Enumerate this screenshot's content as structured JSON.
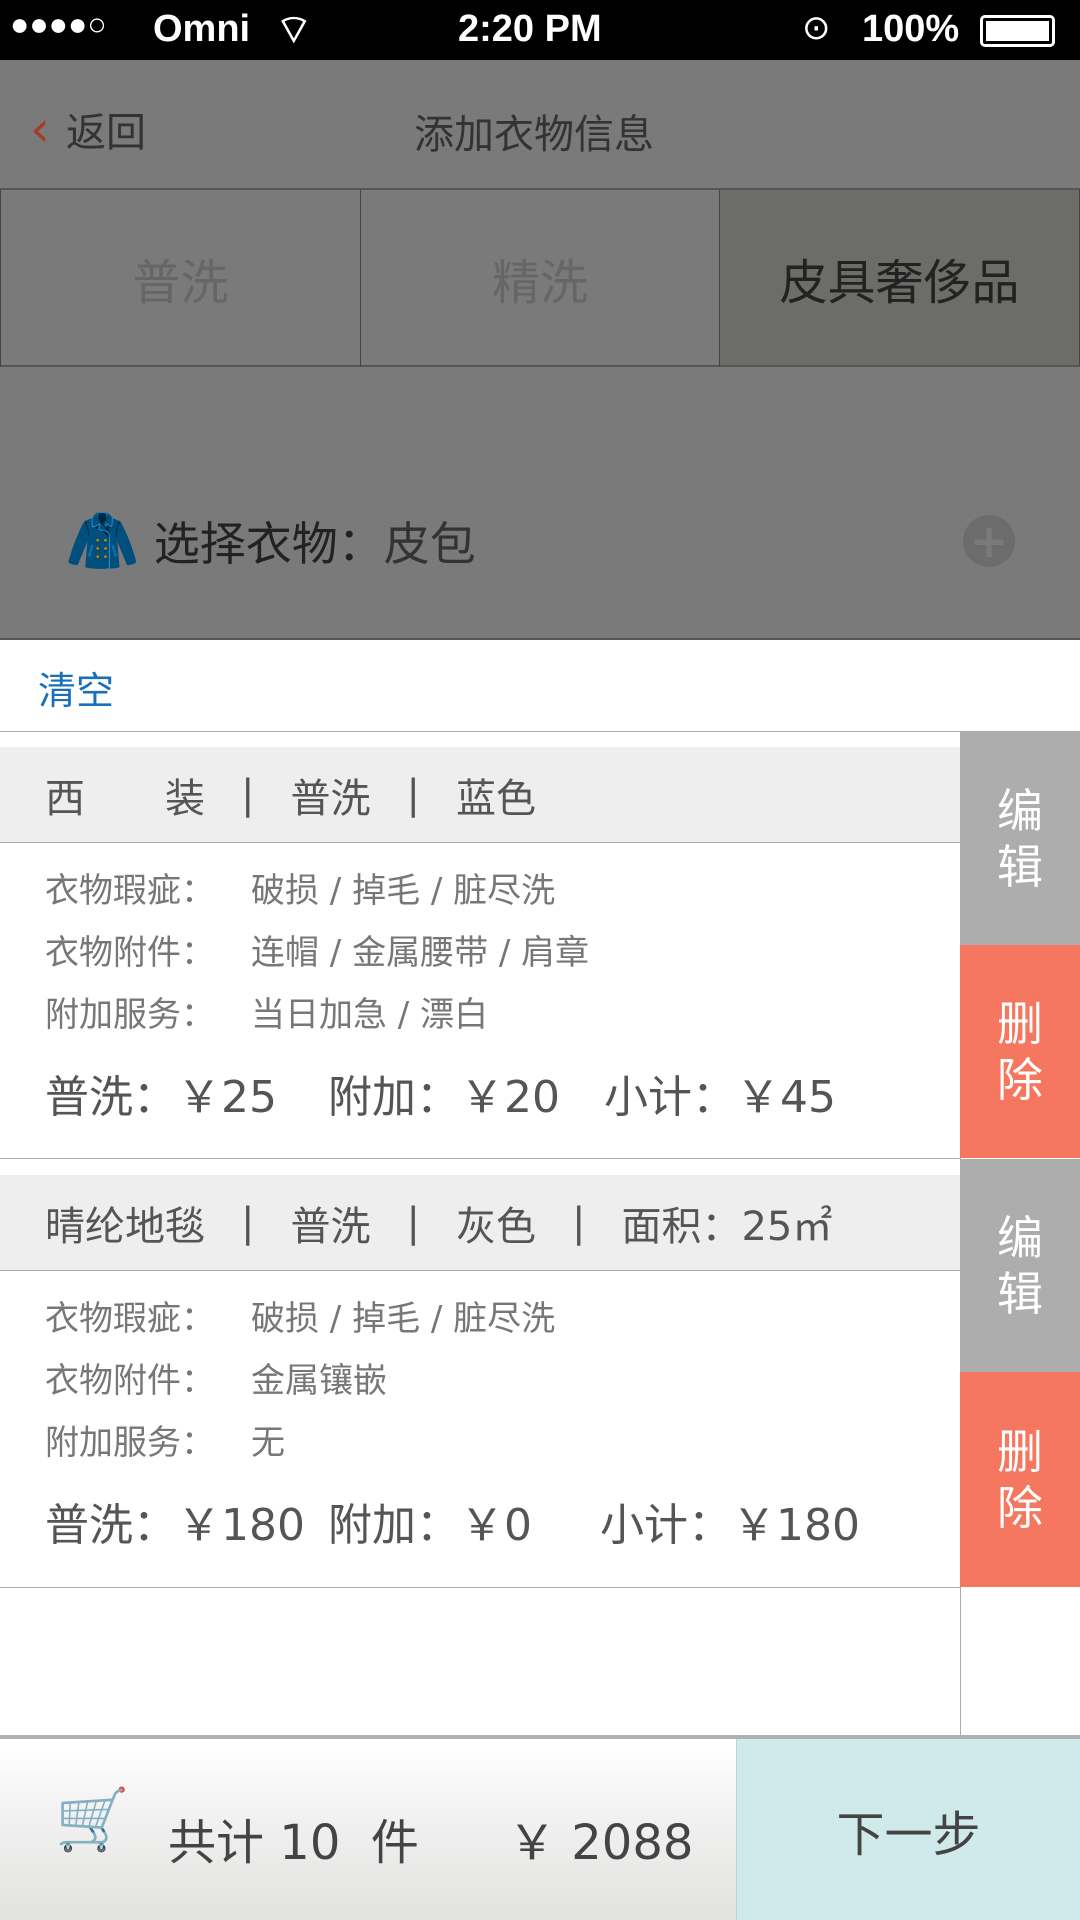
{
  "status_bar": {
    "signal": "●●●●○",
    "carrier": "Omni",
    "time": "2:20 PM",
    "battery": "100%"
  },
  "nav": {
    "back_label": "返回",
    "title": "添加衣物信息"
  },
  "tabs": [
    {
      "label": "普洗",
      "active": false
    },
    {
      "label": "精洗",
      "active": false
    },
    {
      "label": "皮具奢侈品",
      "active": true
    }
  ],
  "select": {
    "label": "选择衣物：",
    "value": "皮包"
  },
  "clear_label": "清空",
  "items": [
    {
      "head": [
        "西　　装",
        "普洗",
        "蓝色"
      ],
      "defects_label": "衣物瑕疵：",
      "defects": "破损 / 掉毛 / 脏尽洗",
      "accessories_label": "衣物附件：",
      "accessories": "连帽 / 金属腰带 / 肩章",
      "services_label": "附加服务：",
      "services": "当日加急 / 漂白",
      "base": "普洗：￥25",
      "extra": "附加：￥20",
      "subtotal": "小计：￥45",
      "edit": "编辑",
      "delete": "删除"
    },
    {
      "head": [
        "晴纶地毯",
        "普洗",
        "灰色",
        "面积：25㎡"
      ],
      "defects_label": "衣物瑕疵：",
      "defects": "破损 / 掉毛 / 脏尽洗",
      "accessories_label": "衣物附件：",
      "accessories": "金属镶嵌",
      "services_label": "附加服务：",
      "services": "无",
      "base": "普洗：￥180",
      "extra": "附加：￥0",
      "subtotal": "小计：￥180",
      "edit": "编辑",
      "delete": "删除"
    }
  ],
  "footer": {
    "total_prefix": "共计",
    "count": "10",
    "unit": "件",
    "amount": "￥ 2088",
    "next": "下一步"
  },
  "colors": {
    "delete": "#f5775f",
    "edit": "#adadad",
    "next_bg": "#d0e9eb",
    "link": "#1a6fb8"
  }
}
